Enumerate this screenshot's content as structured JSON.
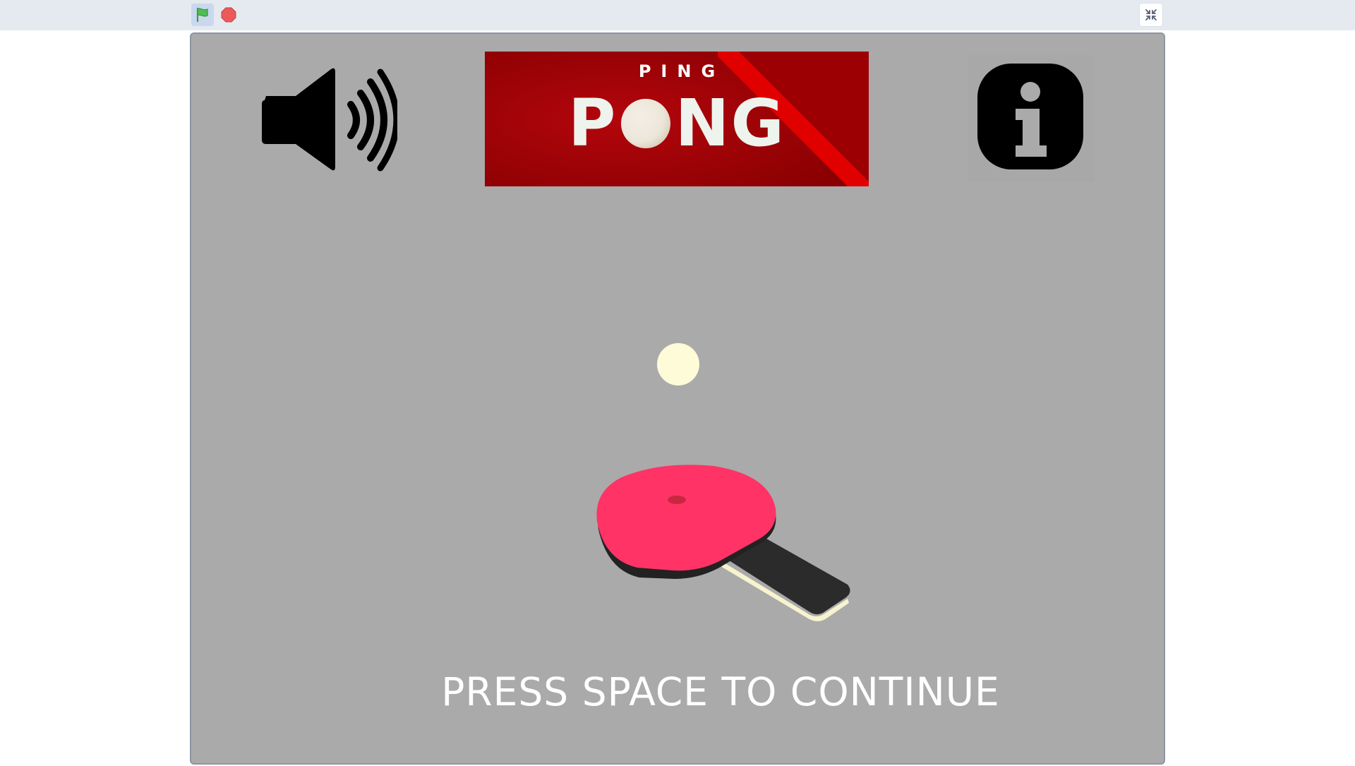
{
  "toolbar": {
    "green_flag_icon": "green-flag-icon",
    "stop_icon": "stop-icon",
    "fullscreen_icon": "exit-fullscreen-icon",
    "flag_color": "#4cbf56",
    "stop_color": "#ec5959"
  },
  "stage": {
    "background_color": "#aaaaaa",
    "logo": {
      "small_text": "PING",
      "big_text_before": "P",
      "big_text_after": "NG",
      "background_color": "#a70004",
      "stripe_color": "#e00000"
    },
    "sound_icon": "speaker-volume-icon",
    "info_icon": "info-icon",
    "ball_color": "#fdfbd8",
    "paddle_color": "#ff3366",
    "prompt": "PRESS SPACE TO CONTINUE"
  }
}
